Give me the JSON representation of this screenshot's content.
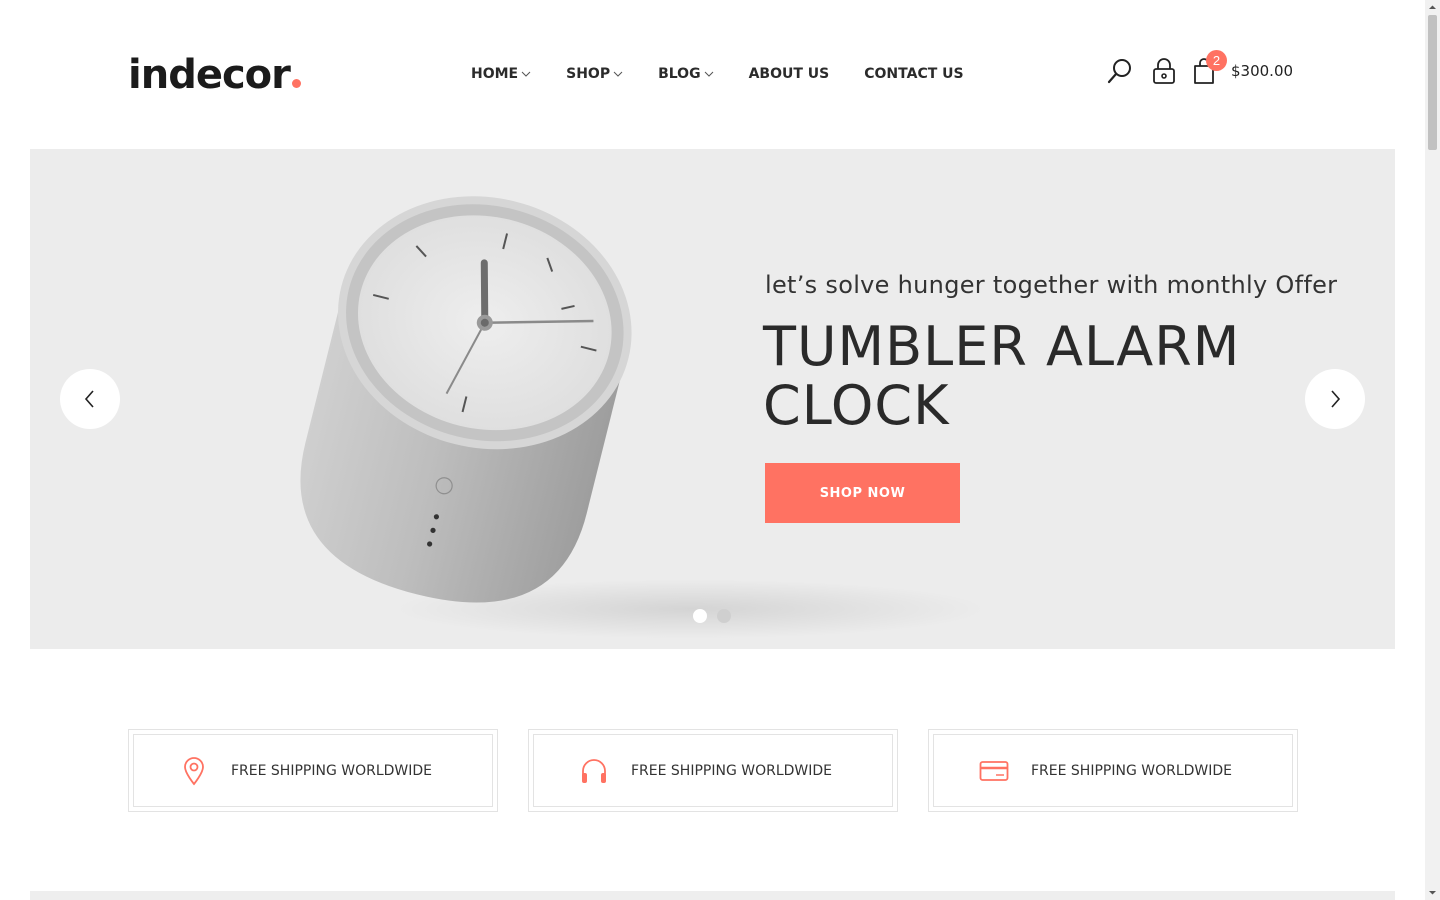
{
  "brand": {
    "name": "indecor",
    "accent_color": "#ff7262"
  },
  "nav": {
    "items": [
      {
        "label": "HOME",
        "has_dropdown": true
      },
      {
        "label": "SHOP",
        "has_dropdown": true
      },
      {
        "label": "BLOG",
        "has_dropdown": true
      },
      {
        "label": "ABOUT US",
        "has_dropdown": false
      },
      {
        "label": "CONTACT US",
        "has_dropdown": false
      }
    ]
  },
  "header_icons": {
    "search": "search-icon",
    "account": "lock-icon",
    "cart": "shopping-bag-icon",
    "cart_count": "2",
    "cart_total": "$300.00"
  },
  "hero": {
    "subtitle": "let’s solve hunger together with monthly Offer",
    "title": "TUMBLER ALARM CLOCK",
    "button_label": "SHOP NOW",
    "background_color": "#ececec",
    "slides_count": 2,
    "active_slide": 1
  },
  "features": [
    {
      "icon": "map-pin-icon",
      "label": "FREE SHIPPING WORLDWIDE"
    },
    {
      "icon": "headphones-icon",
      "label": "FREE SHIPPING WORLDWIDE"
    },
    {
      "icon": "credit-card-icon",
      "label": "FREE SHIPPING WORLDWIDE"
    }
  ]
}
